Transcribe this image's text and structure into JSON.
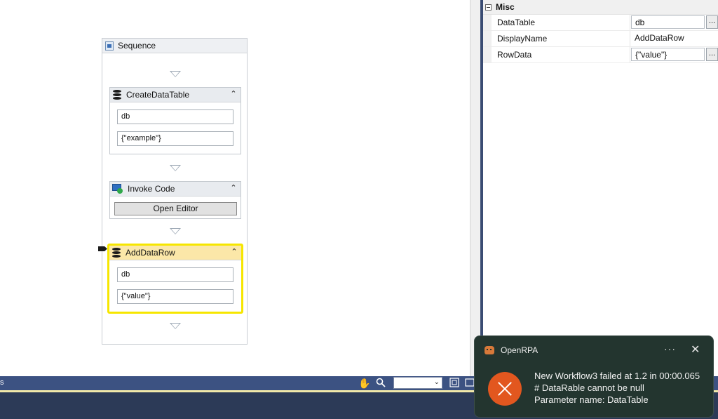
{
  "designer": {
    "sequence": {
      "title": "Sequence"
    },
    "activities": [
      {
        "title": "CreateDataTable",
        "fields": [
          "db",
          "{\"example\"}"
        ]
      },
      {
        "title": "Invoke Code",
        "button": "Open Editor"
      },
      {
        "title": "AddDataRow",
        "fields": [
          "db",
          "{\"value\"}"
        ]
      }
    ]
  },
  "properties": {
    "category": "Misc",
    "rows": [
      {
        "name": "DataTable",
        "value": "db",
        "has_button": true
      },
      {
        "name": "DisplayName",
        "value": "AddDataRow",
        "has_button": false
      },
      {
        "name": "RowData",
        "value": "{\"value\"}",
        "has_button": true
      }
    ],
    "button_label": "..."
  },
  "statusbar": {
    "left_text": "s",
    "icons": [
      "hand-pan-icon",
      "magnifier-icon",
      "fit-to-screen-icon",
      "overview-icon"
    ]
  },
  "toast": {
    "app_name": "OpenRPA",
    "more_label": "···",
    "close_label": "✕",
    "line1": "New Workflow3 failed at 1.2 in 00:00.065",
    "line2": "# DataRable cannot be null",
    "line3": "Parameter name: DataTable"
  },
  "colors": {
    "selection": "#f6e600",
    "error": "#e2571f",
    "toast_bg": "#23352f",
    "statusbar": "#3c5282"
  }
}
